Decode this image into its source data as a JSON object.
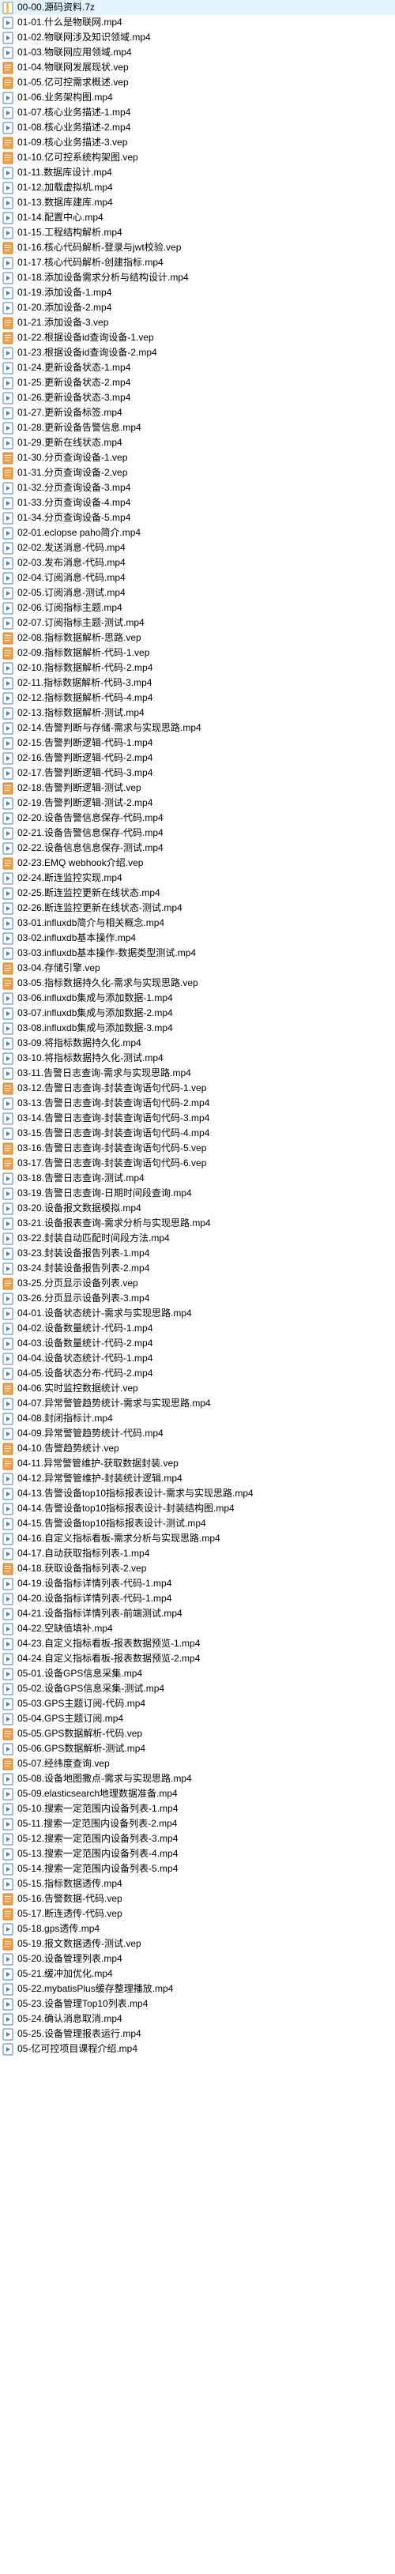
{
  "files": [
    {
      "name": "00-00.源码资料.7z",
      "type": "7z"
    },
    {
      "name": "01-01.什么是物联网.mp4",
      "type": "mp4"
    },
    {
      "name": "01-02.物联网涉及知识领域.mp4",
      "type": "mp4"
    },
    {
      "name": "01-03.物联网应用领域.mp4",
      "type": "mp4"
    },
    {
      "name": "01-04.物联网发展现状.vep",
      "type": "vep"
    },
    {
      "name": "01-05.亿可控需求概述.vep",
      "type": "vep"
    },
    {
      "name": "01-06.业务架构图.mp4",
      "type": "mp4"
    },
    {
      "name": "01-07.核心业务描述-1.mp4",
      "type": "mp4"
    },
    {
      "name": "01-08.核心业务描述-2.mp4",
      "type": "mp4"
    },
    {
      "name": "01-09.核心业务描述-3.vep",
      "type": "vep"
    },
    {
      "name": "01-10.亿可控系统构架图.vep",
      "type": "vep"
    },
    {
      "name": "01-11.数据库设计.mp4",
      "type": "mp4"
    },
    {
      "name": "01-12.加载虚拟机.mp4",
      "type": "mp4"
    },
    {
      "name": "01-13.数据库建库.mp4",
      "type": "mp4"
    },
    {
      "name": "01-14.配置中心.mp4",
      "type": "mp4"
    },
    {
      "name": "01-15.工程结构解析.mp4",
      "type": "mp4"
    },
    {
      "name": "01-16.核心代码解析-登录与jwt校验.vep",
      "type": "vep"
    },
    {
      "name": "01-17.核心代码解析-创建指标.mp4",
      "type": "mp4"
    },
    {
      "name": "01-18.添加设备需求分析与结构设计.mp4",
      "type": "mp4"
    },
    {
      "name": "01-19.添加设备-1.mp4",
      "type": "mp4"
    },
    {
      "name": "01-20.添加设备-2.mp4",
      "type": "mp4"
    },
    {
      "name": "01-21.添加设备-3.vep",
      "type": "vep"
    },
    {
      "name": "01-22.根据设备id查询设备-1.vep",
      "type": "vep"
    },
    {
      "name": "01-23.根据设备id查询设备-2.mp4",
      "type": "mp4"
    },
    {
      "name": "01-24.更新设备状态-1.mp4",
      "type": "mp4"
    },
    {
      "name": "01-25.更新设备状态-2.mp4",
      "type": "mp4"
    },
    {
      "name": "01-26.更新设备状态-3.mp4",
      "type": "mp4"
    },
    {
      "name": "01-27.更新设备标签.mp4",
      "type": "mp4"
    },
    {
      "name": "01-28.更新设备告警信息.mp4",
      "type": "mp4"
    },
    {
      "name": "01-29.更新在线状态.mp4",
      "type": "mp4"
    },
    {
      "name": "01-30.分页查询设备-1.vep",
      "type": "vep"
    },
    {
      "name": "01-31.分页查询设备-2.vep",
      "type": "vep"
    },
    {
      "name": "01-32.分页查询设备-3.mp4",
      "type": "mp4"
    },
    {
      "name": "01-33.分页查询设备-4.mp4",
      "type": "mp4"
    },
    {
      "name": "01-34.分页查询设备-5.mp4",
      "type": "mp4"
    },
    {
      "name": "02-01.eclopse paho简介.mp4",
      "type": "mp4"
    },
    {
      "name": "02-02.发送消息-代码.mp4",
      "type": "mp4"
    },
    {
      "name": "02-03.发布消息-代码.mp4",
      "type": "mp4"
    },
    {
      "name": "02-04.订阅消息-代码.mp4",
      "type": "mp4"
    },
    {
      "name": "02-05.订阅消息-测试.mp4",
      "type": "mp4"
    },
    {
      "name": "02-06.订阅指标主题.mp4",
      "type": "mp4"
    },
    {
      "name": "02-07.订阅指标主题-测试.mp4",
      "type": "mp4"
    },
    {
      "name": "02-08.指标数据解析-思路.vep",
      "type": "vep"
    },
    {
      "name": "02-09.指标数据解析-代码-1.vep",
      "type": "vep"
    },
    {
      "name": "02-10.指标数据解析-代码-2.mp4",
      "type": "mp4"
    },
    {
      "name": "02-11.指标数据解析-代码-3.mp4",
      "type": "mp4"
    },
    {
      "name": "02-12.指标数据解析-代码-4.mp4",
      "type": "mp4"
    },
    {
      "name": "02-13.指标数据解析-测试.mp4",
      "type": "mp4"
    },
    {
      "name": "02-14.告警判断与存储-需求与实现思路.mp4",
      "type": "mp4"
    },
    {
      "name": "02-15.告警判断逻辑-代码-1.mp4",
      "type": "mp4"
    },
    {
      "name": "02-16.告警判断逻辑-代码-2.mp4",
      "type": "mp4"
    },
    {
      "name": "02-17.告警判断逻辑-代码-3.mp4",
      "type": "mp4"
    },
    {
      "name": "02-18.告警判断逻辑-测试.vep",
      "type": "vep"
    },
    {
      "name": "02-19.告警判断逻辑-测试-2.mp4",
      "type": "mp4"
    },
    {
      "name": "02-20.设备告警信息保存-代码.mp4",
      "type": "mp4"
    },
    {
      "name": "02-21.设备告警信息保存-代码.mp4",
      "type": "mp4"
    },
    {
      "name": "02-22.设备信息信息保存-测试.mp4",
      "type": "mp4"
    },
    {
      "name": "02-23.EMQ webhook介绍.vep",
      "type": "vep"
    },
    {
      "name": "02-24.断连监控实现.mp4",
      "type": "mp4"
    },
    {
      "name": "02-25.断连监控更新在线状态.mp4",
      "type": "mp4"
    },
    {
      "name": "02-26.断连监控更新在线状态-测试.mp4",
      "type": "mp4"
    },
    {
      "name": "03-01.influxdb简介与相关概念.mp4",
      "type": "mp4"
    },
    {
      "name": "03-02.influxdb基本操作.mp4",
      "type": "mp4"
    },
    {
      "name": "03-03.influxdb基本操作-数据类型测试.mp4",
      "type": "mp4"
    },
    {
      "name": "03-04.存储引擎.vep",
      "type": "vep"
    },
    {
      "name": "03-05.指标数据持久化-需求与实现思路.vep",
      "type": "vep"
    },
    {
      "name": "03-06.influxdb集成与添加数据-1.mp4",
      "type": "mp4"
    },
    {
      "name": "03-07.influxdb集成与添加数据-2.mp4",
      "type": "mp4"
    },
    {
      "name": "03-08.influxdb集成与添加数据-3.mp4",
      "type": "mp4"
    },
    {
      "name": "03-09.将指标数据持久化.mp4",
      "type": "mp4"
    },
    {
      "name": "03-10.将指标数据持久化-测试.mp4",
      "type": "mp4"
    },
    {
      "name": "03-11.告警日志查询-需求与实现思路.mp4",
      "type": "mp4"
    },
    {
      "name": "03-12.告警日志查询-封装查询语句代码-1.vep",
      "type": "vep"
    },
    {
      "name": "03-13.告警日志查询-封装查询语句代码-2.mp4",
      "type": "mp4"
    },
    {
      "name": "03-14.告警日志查询-封装查询语句代码-3.mp4",
      "type": "mp4"
    },
    {
      "name": "03-15.告警日志查询-封装查询语句代码-4.mp4",
      "type": "mp4"
    },
    {
      "name": "03-16.告警日志查询-封装查询语句代码-5.vep",
      "type": "vep"
    },
    {
      "name": "03-17.告警日志查询-封装查询语句代码-6.vep",
      "type": "vep"
    },
    {
      "name": "03-18.告警日志查询-测试.mp4",
      "type": "mp4"
    },
    {
      "name": "03-19.告警日志查询-日期时间段查询.mp4",
      "type": "mp4"
    },
    {
      "name": "03-20.设备报文数据模拟.mp4",
      "type": "mp4"
    },
    {
      "name": "03-21.设备报表查询-需求分析与实现思路.mp4",
      "type": "mp4"
    },
    {
      "name": "03-22.封装自动匹配时间段方法.mp4",
      "type": "mp4"
    },
    {
      "name": "03-23.封装设备报告列表-1.mp4",
      "type": "mp4"
    },
    {
      "name": "03-24.封装设备报告列表-2.mp4",
      "type": "mp4"
    },
    {
      "name": "03-25.分页显示设备列表.vep",
      "type": "vep"
    },
    {
      "name": "03-26.分页显示设备列表-3.mp4",
      "type": "mp4"
    },
    {
      "name": "04-01.设备状态统计-需求与实现思路.mp4",
      "type": "mp4"
    },
    {
      "name": "04-02.设备数量统计-代码-1.mp4",
      "type": "mp4"
    },
    {
      "name": "04-03.设备数量统计-代码-2.mp4",
      "type": "mp4"
    },
    {
      "name": "04-04.设备状态统计-代码-1.mp4",
      "type": "mp4"
    },
    {
      "name": "04-05.设备状态分布-代码-2.mp4",
      "type": "mp4"
    },
    {
      "name": "04-06.实时监控数据统计.vep",
      "type": "vep"
    },
    {
      "name": "04-07.异常警管趋势统计-需求与实现思路.mp4",
      "type": "mp4"
    },
    {
      "name": "04-08.封闭指标计.mp4",
      "type": "mp4"
    },
    {
      "name": "04-09.异常警管趋势统计-代码.mp4",
      "type": "mp4"
    },
    {
      "name": "04-10.告警趋势统计.vep",
      "type": "vep"
    },
    {
      "name": "04-11.异常警管维护-获取数据封装.vep",
      "type": "vep"
    },
    {
      "name": "04-12.异常警管维护-封装统计逻辑.mp4",
      "type": "mp4"
    },
    {
      "name": "04-13.告警设备top10指标报表设计-需求与实现思路.mp4",
      "type": "mp4"
    },
    {
      "name": "04-14.告警设备top10指标报表设计-封装结构图.mp4",
      "type": "mp4"
    },
    {
      "name": "04-15.告警设备top10指标报表设计-测试.mp4",
      "type": "mp4"
    },
    {
      "name": "04-16.自定义指标看板-需求分析与实现思路.mp4",
      "type": "mp4"
    },
    {
      "name": "04-17.自动获取指标列表-1.mp4",
      "type": "mp4"
    },
    {
      "name": "04-18.获取设备指标列表-2.vep",
      "type": "vep"
    },
    {
      "name": "04-19.设备指标详情列表-代码-1.mp4",
      "type": "mp4"
    },
    {
      "name": "04-20.设备指标详情列表-代码-1.mp4",
      "type": "mp4"
    },
    {
      "name": "04-21.设备指标详情列表-前端测试.mp4",
      "type": "mp4"
    },
    {
      "name": "04-22.空缺值填补.mp4",
      "type": "mp4"
    },
    {
      "name": "04-23.自定义指标看板-报表数据预览-1.mp4",
      "type": "mp4"
    },
    {
      "name": "04-24.自定义指标看板-报表数据预览-2.mp4",
      "type": "mp4"
    },
    {
      "name": "05-01.设备GPS信息采集.mp4",
      "type": "mp4"
    },
    {
      "name": "05-02.设备GPS信息采集-测试.mp4",
      "type": "mp4"
    },
    {
      "name": "05-03.GPS主题订阅-代码.mp4",
      "type": "mp4"
    },
    {
      "name": "05-04.GPS主题订阅.mp4",
      "type": "mp4"
    },
    {
      "name": "05-05.GPS数据解析-代码.vep",
      "type": "vep"
    },
    {
      "name": "05-06.GPS数据解析-测试.mp4",
      "type": "mp4"
    },
    {
      "name": "05-07.经纬度查询.vep",
      "type": "vep"
    },
    {
      "name": "05-08.设备地图撒点-需求与实现思路.mp4",
      "type": "mp4"
    },
    {
      "name": "05-09.elasticsearch地理数据准备.mp4",
      "type": "mp4"
    },
    {
      "name": "05-10.搜索一定范围内设备列表-1.mp4",
      "type": "mp4"
    },
    {
      "name": "05-11.搜索一定范围内设备列表-2.mp4",
      "type": "mp4"
    },
    {
      "name": "05-12.搜索一定范围内设备列表-3.mp4",
      "type": "mp4"
    },
    {
      "name": "05-13.搜索一定范围内设备列表-4.mp4",
      "type": "mp4"
    },
    {
      "name": "05-14.搜索一定范围内设备列表-5.mp4",
      "type": "mp4"
    },
    {
      "name": "05-15.指标数据透传.mp4",
      "type": "mp4"
    },
    {
      "name": "05-16.告警数据-代码.vep",
      "type": "vep"
    },
    {
      "name": "05-17.断连透传-代码.vep",
      "type": "vep"
    },
    {
      "name": "05-18.gps透传.mp4",
      "type": "mp4"
    },
    {
      "name": "05-19.报文数据透传-测试.vep",
      "type": "vep"
    },
    {
      "name": "05-20.设备管理列表.mp4",
      "type": "mp4"
    },
    {
      "name": "05-21.缓冲加优化.mp4",
      "type": "mp4"
    },
    {
      "name": "05-22.mybatisPlus缓存整理播放.mp4",
      "type": "mp4"
    },
    {
      "name": "05-23.设备管理Top10列表.mp4",
      "type": "mp4"
    },
    {
      "name": "05-24.确认消息取消.mp4",
      "type": "mp4"
    },
    {
      "name": "05-25.设备管理报表运行.mp4",
      "type": "mp4"
    },
    {
      "name": "05-亿可控项目课程介绍.mp4",
      "type": "mp4"
    }
  ]
}
